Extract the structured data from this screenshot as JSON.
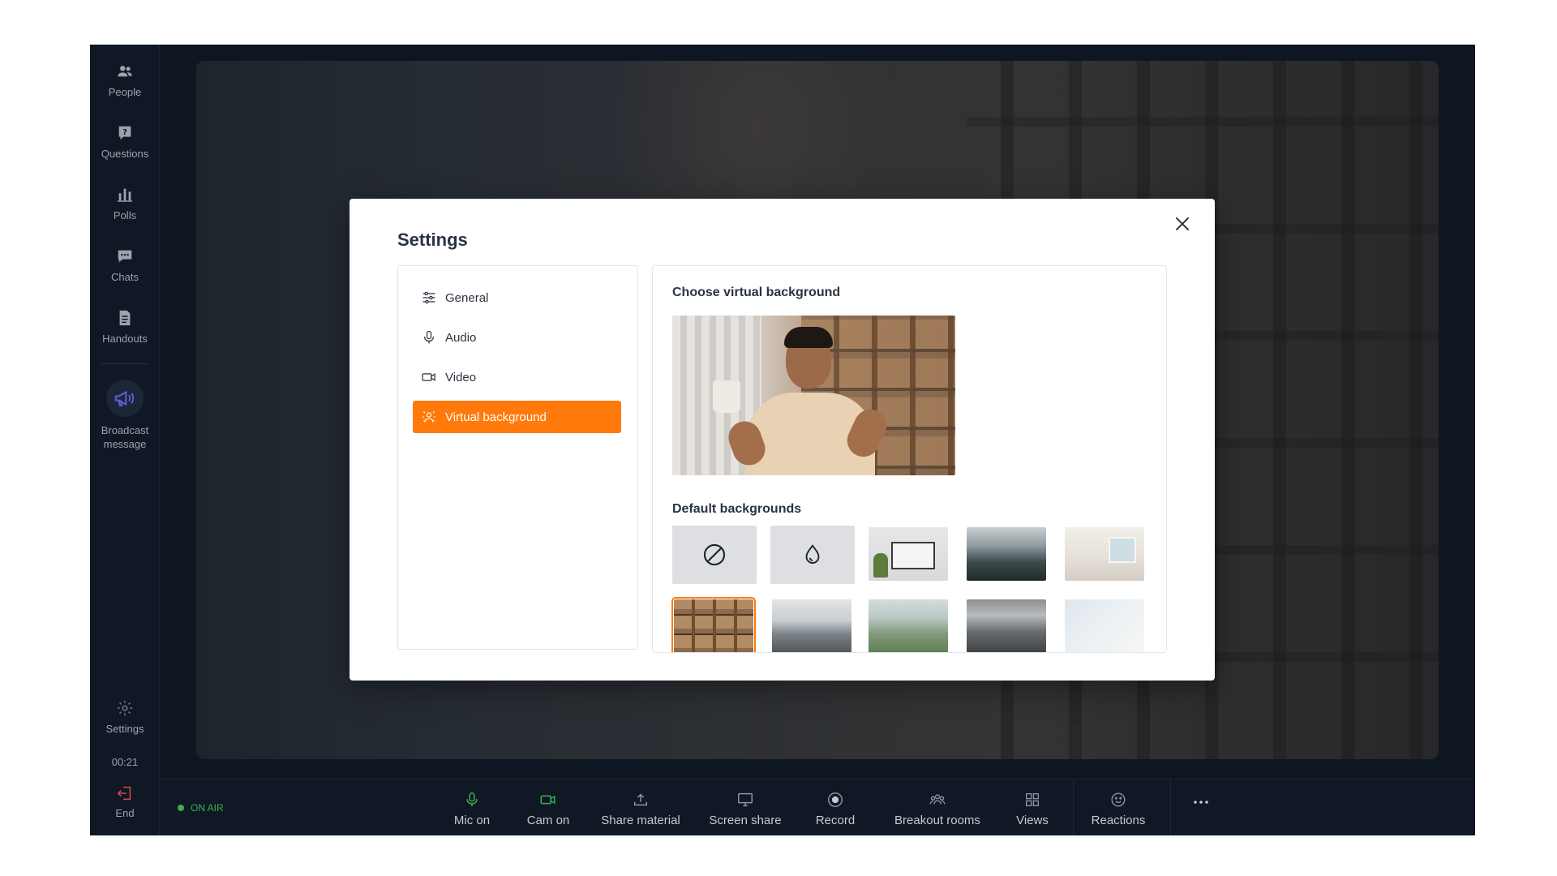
{
  "sidebar": {
    "items": [
      {
        "label": "People",
        "icon": "people-icon"
      },
      {
        "label": "Questions",
        "icon": "question-icon"
      },
      {
        "label": "Polls",
        "icon": "bar-chart-icon"
      },
      {
        "label": "Chats",
        "icon": "chat-icon"
      },
      {
        "label": "Handouts",
        "icon": "document-icon"
      }
    ],
    "broadcast_label_1": "Broadcast",
    "broadcast_label_2": "message",
    "settings_label": "Settings",
    "timer": "00:21",
    "end_label": "End"
  },
  "status": {
    "on_air": "ON AIR",
    "on_air_color": "#3fae55"
  },
  "toolbar": {
    "items": [
      {
        "label": "Mic on",
        "icon": "microphone-icon",
        "color": "#3fae55"
      },
      {
        "label": "Cam on",
        "icon": "camera-icon",
        "color": "#3fae55"
      },
      {
        "label": "Share material",
        "icon": "upload-icon"
      },
      {
        "label": "Screen share",
        "icon": "monitor-icon"
      },
      {
        "label": "Record",
        "icon": "record-icon"
      },
      {
        "label": "Breakout rooms",
        "icon": "group-icon"
      },
      {
        "label": "Views",
        "icon": "grid-icon"
      },
      {
        "label": "Reactions",
        "icon": "smile-icon"
      }
    ],
    "more_icon": "more-dots-icon"
  },
  "settings_modal": {
    "title": "Settings",
    "nav": [
      {
        "label": "General",
        "icon": "sliders-icon",
        "active": false
      },
      {
        "label": "Audio",
        "icon": "microphone-icon",
        "active": false
      },
      {
        "label": "Video",
        "icon": "video-camera-icon",
        "active": false
      },
      {
        "label": "Virtual background",
        "icon": "virtual-background-icon",
        "active": true
      }
    ],
    "accent_color": "#ff7a0a",
    "choose_title": "Choose virtual background",
    "defaults_title": "Default backgrounds",
    "options": [
      {
        "name": "none",
        "icon": "no-background-icon"
      },
      {
        "name": "blur",
        "icon": "blur-drop-icon"
      }
    ],
    "backgrounds_row1": [
      "whiteboard",
      "forest",
      "bright-room"
    ],
    "backgrounds_row2": [
      "bookshelves",
      "mountains",
      "valley",
      "office",
      "light"
    ],
    "selected": "bookshelves"
  }
}
